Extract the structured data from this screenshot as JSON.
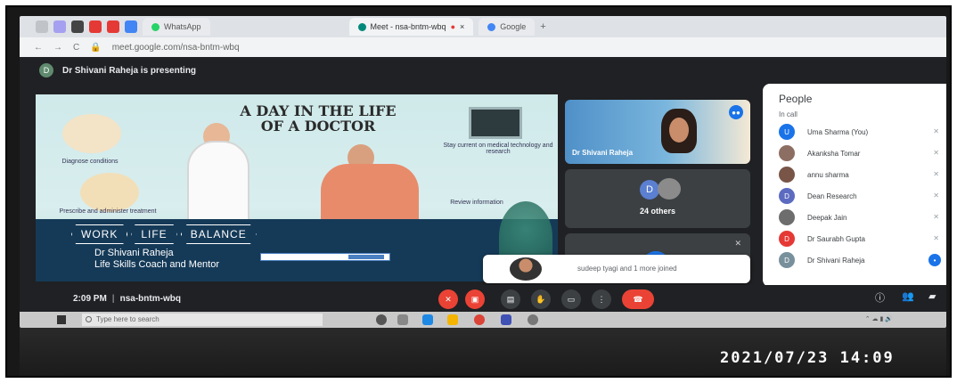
{
  "browser": {
    "tabs": [
      {
        "label": "WhatsApp",
        "dot": "#25d366"
      },
      {
        "label": "Meet - nsa-bntm-wbq",
        "dot": "#00897b"
      },
      {
        "label": "Google",
        "dot": "#4285f4"
      }
    ],
    "url": "meet.google.com/nsa-bntm-wbq"
  },
  "presenting": {
    "badge": "D",
    "text": "Dr Shivani Raheja is presenting"
  },
  "slide": {
    "title": "A Day in The Life of A Doctor",
    "labels": [
      "Diagnose conditions",
      "Stay current on medical technology and research",
      "Prescribe and administer treatment",
      "Review information"
    ],
    "balance": [
      "WORK",
      "LIFE",
      "BALANCE"
    ],
    "presenter_name": "Dr Shivani Raheja",
    "presenter_title": "Life Skills Coach and Mentor"
  },
  "tiles": {
    "speaker_name": "Dr Shivani Raheja",
    "others_avatar": "D",
    "others_count": "24 others"
  },
  "notification": {
    "text": "sudeep tyagi and 1 more joined"
  },
  "people_panel": {
    "title": "People",
    "subtitle": "In call",
    "people": [
      {
        "initial": "U",
        "name": "Uma Sharma (You)",
        "color": "#1a73e8"
      },
      {
        "initial": "",
        "name": "Akanksha Tomar",
        "color": "#8d6e63"
      },
      {
        "initial": "",
        "name": "annu sharma",
        "color": "#795548"
      },
      {
        "initial": "D",
        "name": "Dean Research",
        "color": "#5c6bc0"
      },
      {
        "initial": "",
        "name": "Deepak Jain",
        "color": "#6d6d6d"
      },
      {
        "initial": "D",
        "name": "Dr Saurabh Gupta",
        "color": "#e53935"
      },
      {
        "initial": "D",
        "name": "Dr Shivani Raheja",
        "color": "#78909c"
      }
    ]
  },
  "meet_bar": {
    "time": "2:09 PM",
    "code": "nsa-bntm-wbq"
  },
  "taskbar": {
    "search_placeholder": "Type here to search"
  },
  "photo_timestamp": "2021/07/23 14:09"
}
